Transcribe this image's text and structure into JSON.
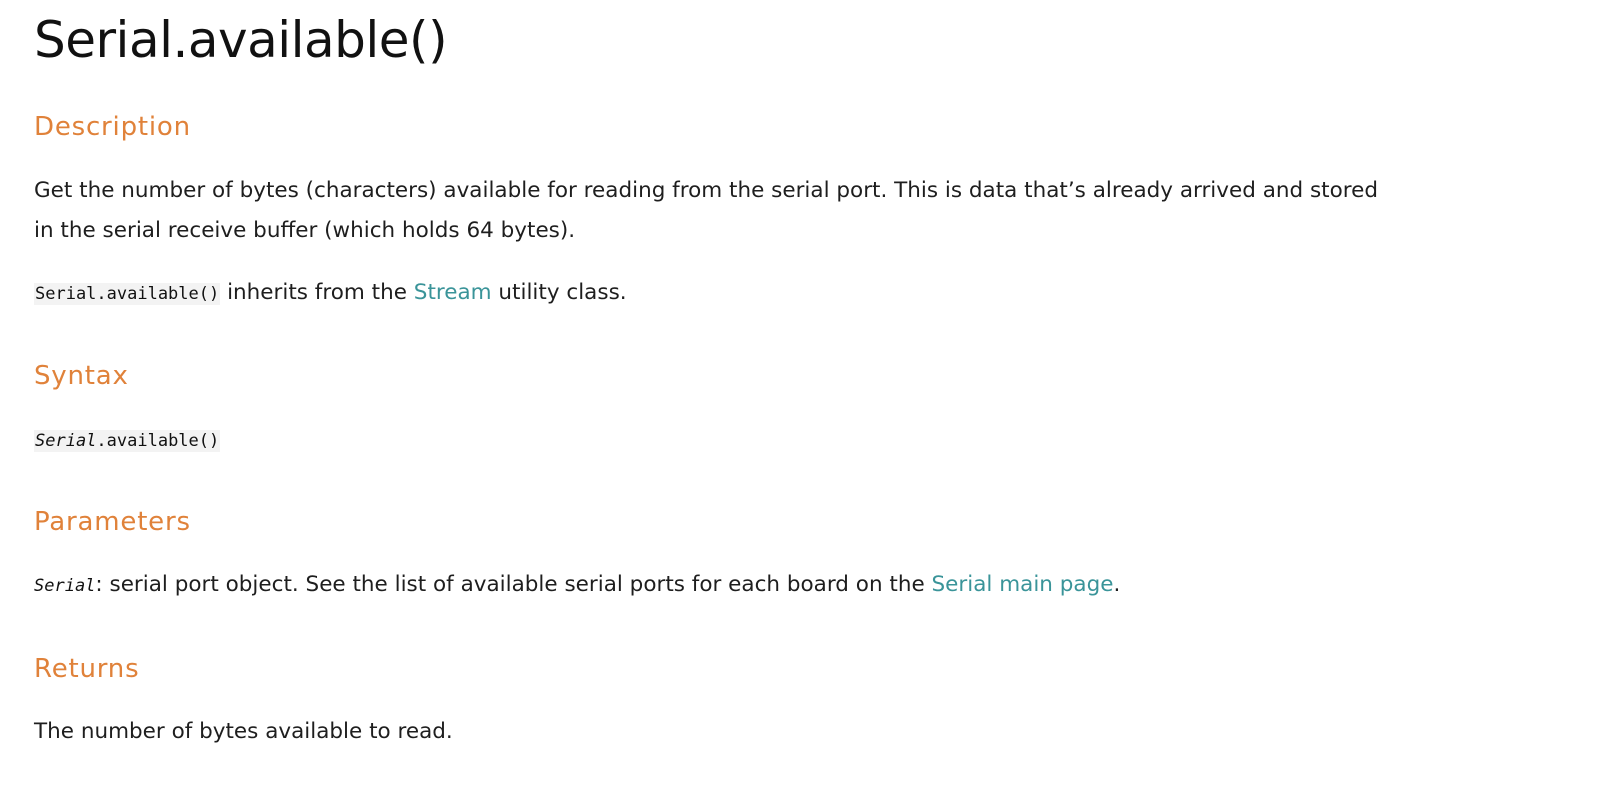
{
  "title": "Serial.available()",
  "sections": {
    "description": {
      "heading": "Description",
      "para1": "Get the number of bytes (characters) available for reading from the serial port. This is data that’s already arrived and stored in the serial receive buffer (which holds 64 bytes).",
      "para2": {
        "code": "Serial.available()",
        "text_before_link": " inherits from the ",
        "link": "Stream",
        "text_after_link": " utility class."
      }
    },
    "syntax": {
      "heading": "Syntax",
      "code_italic": "Serial",
      "code_rest": ".available()"
    },
    "parameters": {
      "heading": "Parameters",
      "param_name": "Serial",
      "text_before_link": ": serial port object. See the list of available serial ports for each board on the ",
      "link": "Serial main page",
      "text_after_link": "."
    },
    "returns": {
      "heading": "Returns",
      "text": "The number of bytes available to read."
    }
  },
  "colors": {
    "heading": "#e0823a",
    "link": "#3a9499",
    "text": "#1e1e1e"
  }
}
